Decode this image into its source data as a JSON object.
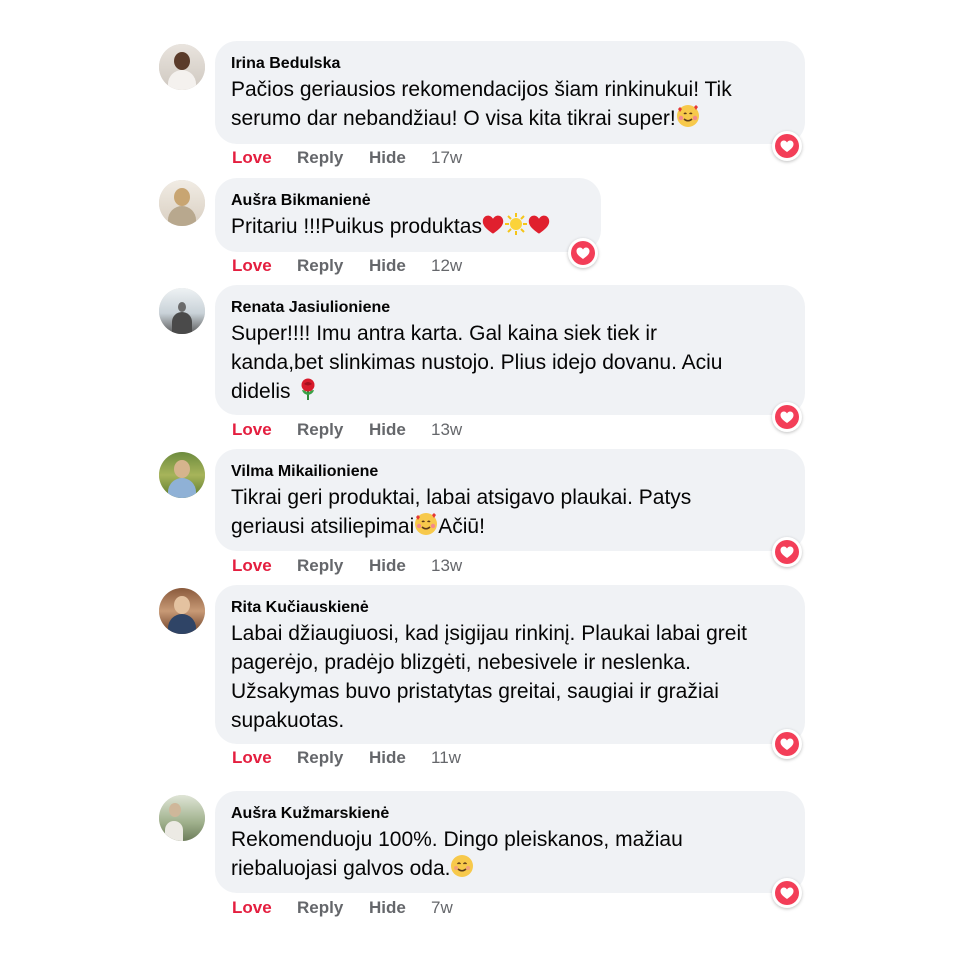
{
  "reaction": {
    "icon": "love-heart-icon",
    "color": "#f33e58"
  },
  "action_labels": {
    "love": "Love",
    "reply": "Reply",
    "hide": "Hide"
  },
  "colors": {
    "love_text": "#e41e3f",
    "muted_text": "#65676b",
    "bubble": "#f0f2f5"
  },
  "comments": [
    {
      "author": "Irina Bedulska",
      "text_lines": [
        "Pačios geriausios rekomendacijos šiam rinkinukui! Tik",
        "serumo dar nebandžiau! O visa kita tikrai super!"
      ],
      "emojis": [
        "smiling-face-with-hearts-icon"
      ],
      "time": "17w"
    },
    {
      "author": "Aušra Bikmanienė",
      "text_lines": [
        "Pritariu !!!Puikus produktas"
      ],
      "emojis": [
        "red-heart-icon",
        "sun-icon",
        "red-heart-icon"
      ],
      "time": "12w"
    },
    {
      "author": "Renata Jasiulioniene",
      "text_lines": [
        "Super!!!! Imu antra karta. Gal kaina siek tiek ir",
        "kanda,bet slinkimas nustojo. Plius idejo dovanu. Aciu",
        "didelis"
      ],
      "emojis": [
        "rose-icon"
      ],
      "time": "13w"
    },
    {
      "author": "Vilma Mikailioniene",
      "text_lines": [
        "Tikrai geri produktai, labai atsigavo plaukai. Patys",
        "geriausi atsiliepimai",
        "Ačiū!"
      ],
      "emojis": [
        "smiling-face-with-hearts-icon"
      ],
      "time": "13w"
    },
    {
      "author": "Rita Kučiauskienė",
      "text_lines": [
        "Labai džiaugiuosi, kad įsigijau rinkinį. Plaukai labai greit",
        "pagerėjo, pradėjo blizgėti, nebesivele ir neslenka.",
        "Užsakymas buvo pristatytas greitai, saugiai ir gražiai",
        "supakuotas."
      ],
      "emojis": [],
      "time": "11w"
    },
    {
      "author": "Aušra Kužmarskienė",
      "text_lines": [
        "Rekomenduoju 100%. Dingo pleiskanos, mažiau",
        "riebaluojasi galvos oda."
      ],
      "emojis": [
        "smiling-face-icon"
      ],
      "time": "7w"
    }
  ]
}
